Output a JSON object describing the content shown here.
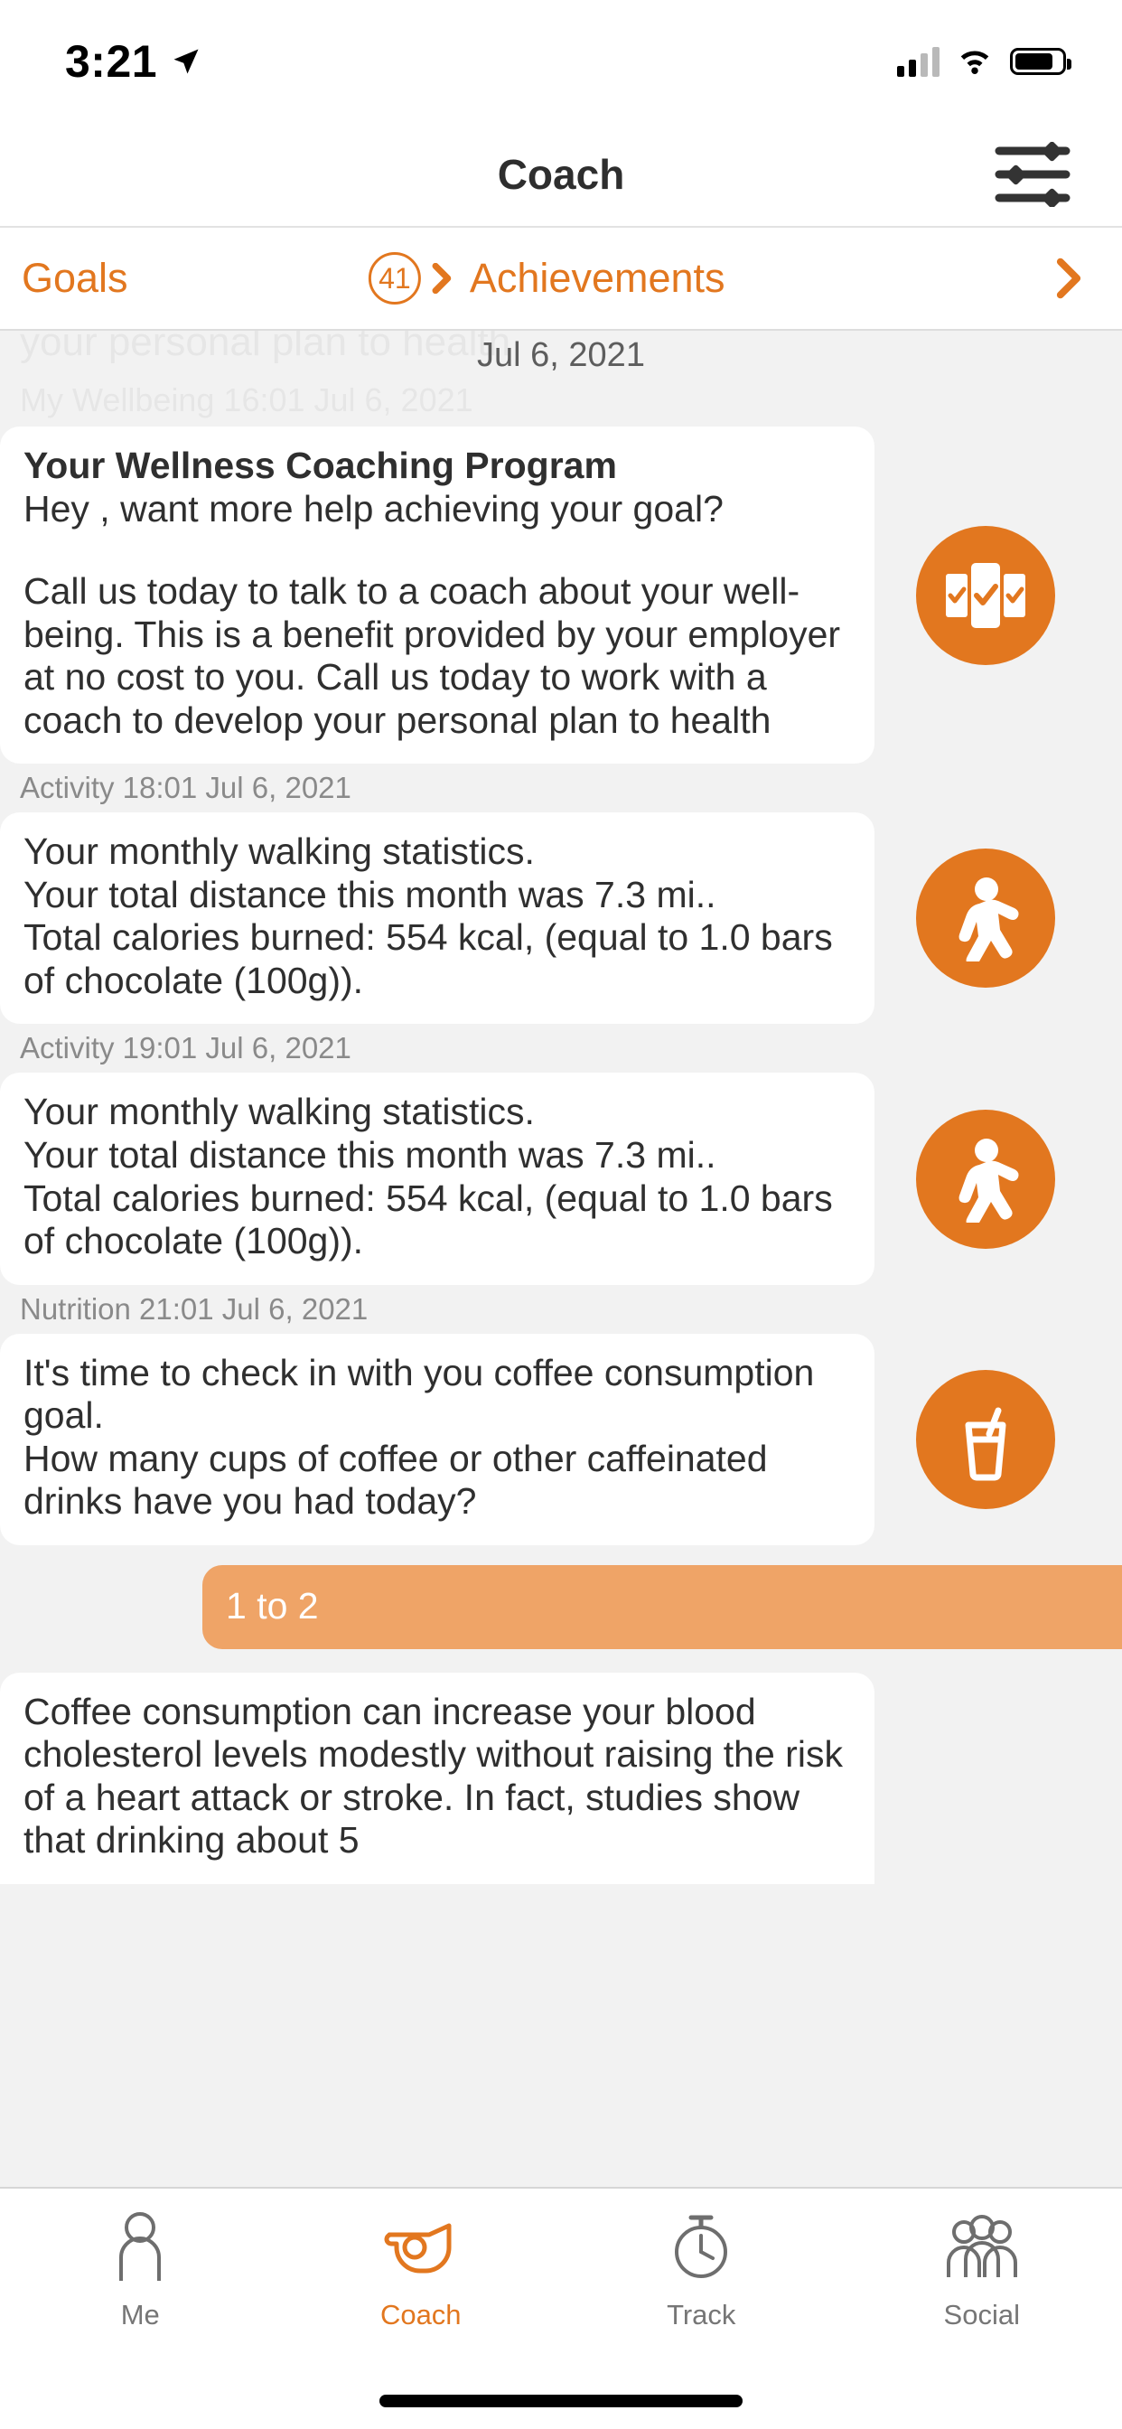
{
  "status_bar": {
    "time": "3:21",
    "location_icon": "location-arrow-icon",
    "signal_icon": "cellular-signal-icon",
    "wifi_icon": "wifi-icon",
    "battery_icon": "battery-icon"
  },
  "header": {
    "title": "Coach",
    "settings_icon": "sliders-icon"
  },
  "segment_nav": {
    "goals_label": "Goals",
    "achievements_badge": "41",
    "achievements_label": "Achievements",
    "left_chevron_icon": "chevron-right-icon",
    "right_chevron_icon": "chevron-right-icon"
  },
  "feed": {
    "scrolled_ghost_text_1": "your personal plan to health",
    "scrolled_ghost_text_2": "My Wellbeing 16:01 Jul 6, 2021",
    "date_header": "Jul 6, 2021",
    "messages": [
      {
        "label": "",
        "title": "Your Wellness Coaching Program",
        "line1": "Hey        , want more help achieving your goal?",
        "line2": "Call us today to talk to a coach about your well-being. This is a benefit provided by your employer at no cost to you.  Call us today to work with a coach to develop your personal plan to health",
        "icon": "wellness-cards-check-icon"
      },
      {
        "label": "Activity 18:01 Jul 6, 2021",
        "line1": "Your monthly walking statistics.",
        "line2": "Your total distance this month was 7.3 mi..",
        "line3": "Total calories burned: 554 kcal, (equal to 1.0 bars of chocolate (100g)).",
        "icon": "walking-person-icon"
      },
      {
        "label": "Activity 19:01 Jul 6, 2021",
        "line1": "Your monthly walking statistics.",
        "line2": "Your total distance this month was 7.3 mi..",
        "line3": "Total calories burned: 554 kcal, (equal to 1.0 bars of chocolate (100g)).",
        "icon": "walking-person-icon"
      },
      {
        "label": "Nutrition 21:01 Jul 6, 2021",
        "line1": "It's time to check in with you coffee consumption goal.",
        "line2": "How many cups of coffee or other caffeinated drinks have you had today?",
        "icon": "drink-cup-icon"
      }
    ],
    "user_reply": "1 to 2",
    "final_message": "Coffee consumption can increase your blood cholesterol levels modestly without raising the risk of a heart attack or stroke. In fact, studies show that drinking about 5"
  },
  "tab_bar": {
    "tabs": [
      {
        "label": "Me",
        "icon": "person-outline-icon",
        "active": false
      },
      {
        "label": "Coach",
        "icon": "whistle-icon",
        "active": true
      },
      {
        "label": "Track",
        "icon": "stopwatch-icon",
        "active": false
      },
      {
        "label": "Social",
        "icon": "people-group-icon",
        "active": false
      }
    ]
  },
  "colors": {
    "accent": "#E2771F",
    "reply_bubble": "#EFA467",
    "background": "#F2F2F2",
    "card": "#FFFFFF",
    "text": "#2F2F2F",
    "muted": "#8A8A8A"
  }
}
